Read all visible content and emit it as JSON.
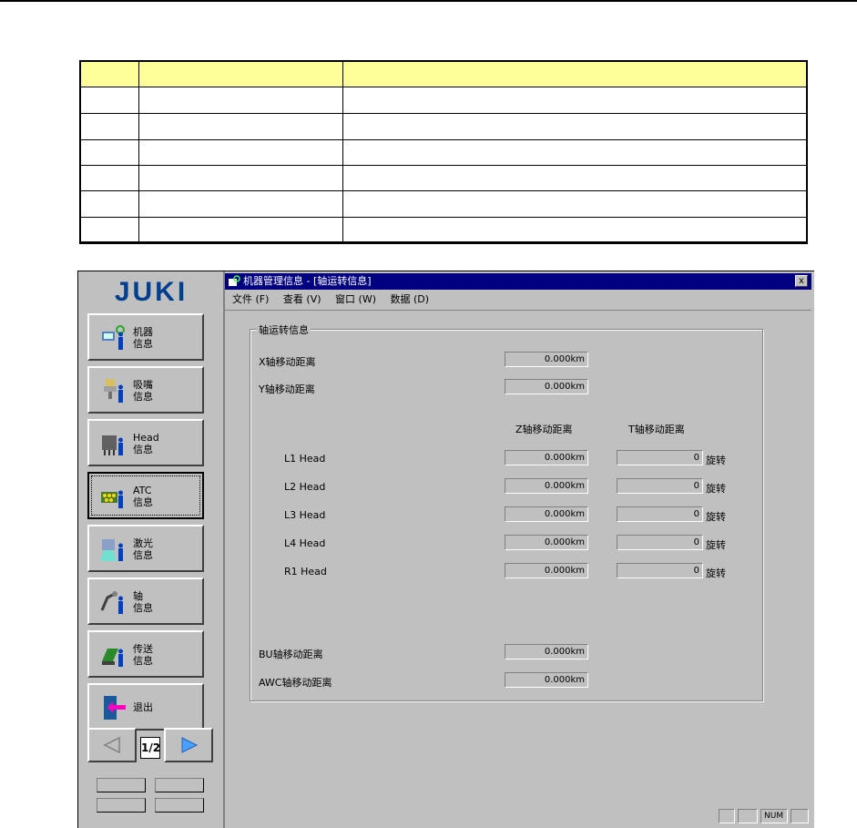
{
  "table": {
    "rows": 7
  },
  "app": {
    "logo": "JUKI",
    "window_title": "机器管理信息 - [轴运转信息]",
    "close_label": "x",
    "menu": [
      "文件 (F)",
      "查看 (V)",
      "窗口 (W)",
      "数据 (D)"
    ],
    "nav": [
      {
        "label": "机器\n信息",
        "icon": "machine-info-icon"
      },
      {
        "label": "吸嘴\n信息",
        "icon": "nozzle-info-icon"
      },
      {
        "label": "Head\n信息",
        "icon": "head-info-icon"
      },
      {
        "label": "ATC\n信息",
        "icon": "atc-info-icon"
      },
      {
        "label": "激光\n信息",
        "icon": "laser-info-icon"
      },
      {
        "label": "轴\n信息",
        "icon": "axis-info-icon"
      },
      {
        "label": "传送\n信息",
        "icon": "conveyor-info-icon"
      },
      {
        "label": "退出",
        "icon": "exit-icon"
      }
    ],
    "page_indicator": "1/2",
    "group_title": "轴运转信息",
    "x_label": "X轴移动距离",
    "x_value": "0.000km",
    "y_label": "Y轴移动距离",
    "y_value": "0.000km",
    "col_z": "Z轴移动距离",
    "col_t": "T轴移动距离",
    "heads": [
      {
        "name": "L1 Head",
        "z": "0.000km",
        "t": "0",
        "unit": "旋转"
      },
      {
        "name": "L2 Head",
        "z": "0.000km",
        "t": "0",
        "unit": "旋转"
      },
      {
        "name": "L3 Head",
        "z": "0.000km",
        "t": "0",
        "unit": "旋转"
      },
      {
        "name": "L4 Head",
        "z": "0.000km",
        "t": "0",
        "unit": "旋转"
      },
      {
        "name": "R1 Head",
        "z": "0.000km",
        "t": "0",
        "unit": "旋转"
      }
    ],
    "bu_label": "BU轴移动距离",
    "bu_value": "0.000km",
    "awc_label": "AWC轴移动距离",
    "awc_value": "0.000km",
    "status_num": "NUM"
  }
}
